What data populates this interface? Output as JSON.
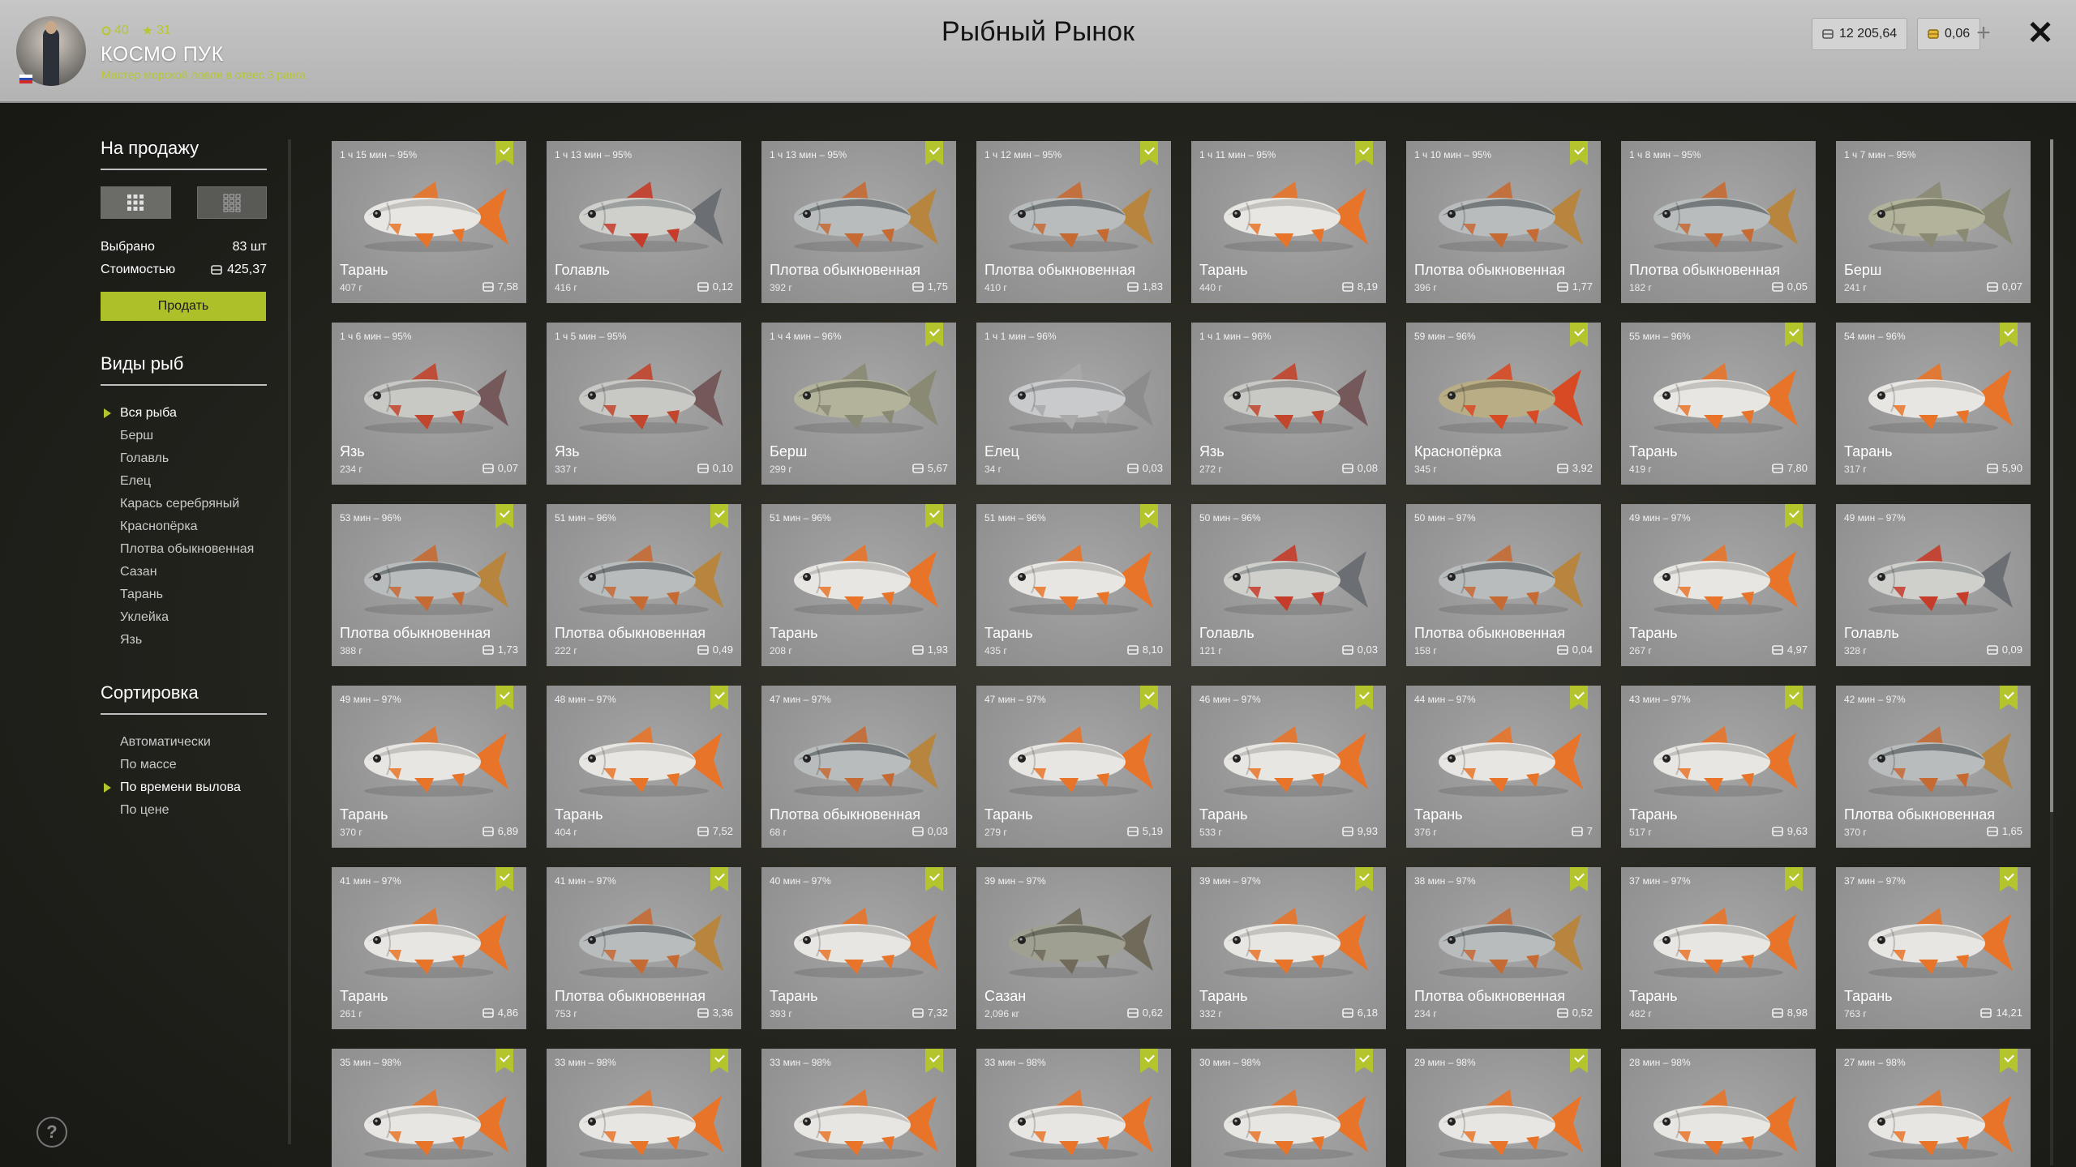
{
  "header": {
    "title": "Рыбный Рынок",
    "player": {
      "name": "КОСМО ПУК",
      "level": "40",
      "stars": "31",
      "rank": "Мастер морской ловли в отвес 3 ранга"
    },
    "silver": "12 205,64",
    "gold": "0,06",
    "plus_label": "+",
    "close_label": "✕"
  },
  "sidebar": {
    "sale_title": "На продажу",
    "selected_label": "Выбрано",
    "selected_value": "83 шт",
    "cost_label": "Стоимостью",
    "cost_value": "425,37",
    "sell_label": "Продать",
    "species_title": "Виды рыб",
    "species": [
      "Вся рыба",
      "Берш",
      "Голавль",
      "Елец",
      "Карась серебряный",
      "Краснопёрка",
      "Плотва обыкновенная",
      "Сазан",
      "Тарань",
      "Уклейка",
      "Язь"
    ],
    "species_selected": 0,
    "sort_title": "Сортировка",
    "sort": [
      "Автоматически",
      "По массе",
      "По времени вылова",
      "По цене"
    ],
    "sort_selected": 2
  },
  "help_label": "?",
  "fish": [
    {
      "time": "1 ч 15 мин – 95%",
      "name": "Тарань",
      "weight": "407 г",
      "price": "7,58",
      "bookmark": true
    },
    {
      "time": "1 ч 13 мин – 95%",
      "name": "Голавль",
      "weight": "416 г",
      "price": "0,12",
      "bookmark": false
    },
    {
      "time": "1 ч 13 мин – 95%",
      "name": "Плотва обыкновенная",
      "weight": "392 г",
      "price": "1,75",
      "bookmark": true
    },
    {
      "time": "1 ч 12 мин – 95%",
      "name": "Плотва обыкновенная",
      "weight": "410 г",
      "price": "1,83",
      "bookmark": true
    },
    {
      "time": "1 ч 11 мин – 95%",
      "name": "Тарань",
      "weight": "440 г",
      "price": "8,19",
      "bookmark": true
    },
    {
      "time": "1 ч 10 мин – 95%",
      "name": "Плотва обыкновенная",
      "weight": "396 г",
      "price": "1,77",
      "bookmark": true
    },
    {
      "time": "1 ч 8 мин – 95%",
      "name": "Плотва обыкновенная",
      "weight": "182 г",
      "price": "0,05",
      "bookmark": false
    },
    {
      "time": "1 ч 7 мин – 95%",
      "name": "Берш",
      "weight": "241 г",
      "price": "0,07",
      "bookmark": false
    },
    {
      "time": "1 ч 6 мин – 95%",
      "name": "Язь",
      "weight": "234 г",
      "price": "0,07",
      "bookmark": false
    },
    {
      "time": "1 ч 5 мин – 95%",
      "name": "Язь",
      "weight": "337 г",
      "price": "0,10",
      "bookmark": false
    },
    {
      "time": "1 ч 4 мин – 96%",
      "name": "Берш",
      "weight": "299 г",
      "price": "5,67",
      "bookmark": true
    },
    {
      "time": "1 ч 1 мин – 96%",
      "name": "Елец",
      "weight": "34 г",
      "price": "0,03",
      "bookmark": false
    },
    {
      "time": "1 ч 1 мин – 96%",
      "name": "Язь",
      "weight": "272 г",
      "price": "0,08",
      "bookmark": false
    },
    {
      "time": "59 мин – 96%",
      "name": "Краснопёрка",
      "weight": "345 г",
      "price": "3,92",
      "bookmark": true
    },
    {
      "time": "55 мин – 96%",
      "name": "Тарань",
      "weight": "419 г",
      "price": "7,80",
      "bookmark": true
    },
    {
      "time": "54 мин – 96%",
      "name": "Тарань",
      "weight": "317 г",
      "price": "5,90",
      "bookmark": true
    },
    {
      "time": "53 мин – 96%",
      "name": "Плотва обыкновенная",
      "weight": "388 г",
      "price": "1,73",
      "bookmark": true
    },
    {
      "time": "51 мин – 96%",
      "name": "Плотва обыкновенная",
      "weight": "222 г",
      "price": "0,49",
      "bookmark": true
    },
    {
      "time": "51 мин – 96%",
      "name": "Тарань",
      "weight": "208 г",
      "price": "1,93",
      "bookmark": true
    },
    {
      "time": "51 мин – 96%",
      "name": "Тарань",
      "weight": "435 г",
      "price": "8,10",
      "bookmark": true
    },
    {
      "time": "50 мин – 96%",
      "name": "Голавль",
      "weight": "121 г",
      "price": "0,03",
      "bookmark": false
    },
    {
      "time": "50 мин – 97%",
      "name": "Плотва обыкновенная",
      "weight": "158 г",
      "price": "0,04",
      "bookmark": false
    },
    {
      "time": "49 мин – 97%",
      "name": "Тарань",
      "weight": "267 г",
      "price": "4,97",
      "bookmark": true
    },
    {
      "time": "49 мин – 97%",
      "name": "Голавль",
      "weight": "328 г",
      "price": "0,09",
      "bookmark": false
    },
    {
      "time": "49 мин – 97%",
      "name": "Тарань",
      "weight": "370 г",
      "price": "6,89",
      "bookmark": true
    },
    {
      "time": "48 мин – 97%",
      "name": "Тарань",
      "weight": "404 г",
      "price": "7,52",
      "bookmark": true
    },
    {
      "time": "47 мин – 97%",
      "name": "Плотва обыкновенная",
      "weight": "68 г",
      "price": "0,03",
      "bookmark": false
    },
    {
      "time": "47 мин – 97%",
      "name": "Тарань",
      "weight": "279 г",
      "price": "5,19",
      "bookmark": true
    },
    {
      "time": "46 мин – 97%",
      "name": "Тарань",
      "weight": "533 г",
      "price": "9,93",
      "bookmark": true
    },
    {
      "time": "44 мин – 97%",
      "name": "Тарань",
      "weight": "376 г",
      "price": "7",
      "bookmark": true
    },
    {
      "time": "43 мин – 97%",
      "name": "Тарань",
      "weight": "517 г",
      "price": "9,63",
      "bookmark": true
    },
    {
      "time": "42 мин – 97%",
      "name": "Плотва обыкновенная",
      "weight": "370 г",
      "price": "1,65",
      "bookmark": true
    },
    {
      "time": "41 мин – 97%",
      "name": "Тарань",
      "weight": "261 г",
      "price": "4,86",
      "bookmark": true
    },
    {
      "time": "41 мин – 97%",
      "name": "Плотва обыкновенная",
      "weight": "753 г",
      "price": "3,36",
      "bookmark": true
    },
    {
      "time": "40 мин – 97%",
      "name": "Тарань",
      "weight": "393 г",
      "price": "7,32",
      "bookmark": true
    },
    {
      "time": "39 мин – 97%",
      "name": "Сазан",
      "weight": "2,096 кг",
      "price": "0,62",
      "bookmark": false
    },
    {
      "time": "39 мин – 97%",
      "name": "Тарань",
      "weight": "332 г",
      "price": "6,18",
      "bookmark": true
    },
    {
      "time": "38 мин – 97%",
      "name": "Плотва обыкновенная",
      "weight": "234 г",
      "price": "0,52",
      "bookmark": true
    },
    {
      "time": "37 мин – 97%",
      "name": "Тарань",
      "weight": "482 г",
      "price": "8,98",
      "bookmark": true
    },
    {
      "time": "37 мин – 97%",
      "name": "Тарань",
      "weight": "763 г",
      "price": "14,21",
      "bookmark": true
    },
    {
      "time": "35 мин – 98%",
      "name": "",
      "weight": "",
      "price": "",
      "bookmark": true
    },
    {
      "time": "33 мин – 98%",
      "name": "",
      "weight": "",
      "price": "",
      "bookmark": true
    },
    {
      "time": "33 мин – 98%",
      "name": "",
      "weight": "",
      "price": "",
      "bookmark": true
    },
    {
      "time": "33 мин – 98%",
      "name": "",
      "weight": "",
      "price": "",
      "bookmark": true
    },
    {
      "time": "30 мин – 98%",
      "name": "",
      "weight": "",
      "price": "",
      "bookmark": true
    },
    {
      "time": "29 мин – 98%",
      "name": "",
      "weight": "",
      "price": "",
      "bookmark": true
    },
    {
      "time": "28 мин – 98%",
      "name": "",
      "weight": "",
      "price": "",
      "bookmark": false
    },
    {
      "time": "27 мин – 98%",
      "name": "",
      "weight": "",
      "price": "",
      "bookmark": true
    }
  ],
  "fish_art": {
    "Тарань": {
      "body": "#e8e6e2",
      "back": "#b8b6b2",
      "fin": "#e8742a",
      "tail": "#e8742a"
    },
    "Голавль": {
      "body": "#cfd0cc",
      "back": "#8a8f8d",
      "fin": "#c53c2a",
      "tail": "#6b6f74"
    },
    "Плотва обыкновенная": {
      "body": "#b9bcbc",
      "back": "#5f6668",
      "fin": "#c66a34",
      "tail": "#b8853e"
    },
    "Берш": {
      "body": "#b3b29a",
      "back": "#6a6c58",
      "fin": "#8a8a74",
      "tail": "#8a8a74"
    },
    "Язь": {
      "body": "#c8c8c4",
      "back": "#8d8f8e",
      "fin": "#c2452e",
      "tail": "#74585a"
    },
    "Елец": {
      "body": "#c9cacc",
      "back": "#8d9092",
      "fin": "#a9a9a9",
      "tail": "#8c8c8c"
    },
    "Краснопёрка": {
      "body": "#b9ad86",
      "back": "#7c7458",
      "fin": "#d84a24",
      "tail": "#d84a24"
    },
    "Сазан": {
      "body": "#9fa091",
      "back": "#595e52",
      "fin": "#6f6a5a",
      "tail": "#6f6a5a"
    },
    "": {
      "body": "#e8e6e2",
      "back": "#b8b6b2",
      "fin": "#e8742a",
      "tail": "#e8742a"
    }
  }
}
